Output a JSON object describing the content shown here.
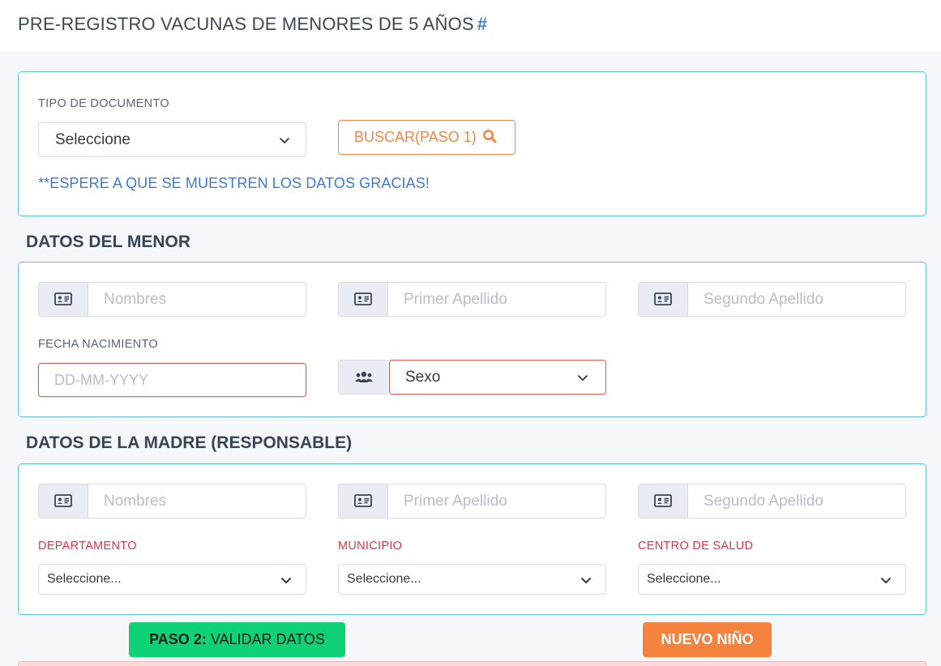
{
  "header": {
    "title": "PRE-REGISTRO VACUNAS DE MENORES DE 5 AÑOS",
    "hash": "#"
  },
  "search": {
    "doc_type_label": "TIPO DE DOCUMENTO",
    "doc_type_value": "Seleccione",
    "search_button": "BUSCAR(PASO 1)",
    "wait_message": "**ESPERE A QUE SE MUESTREN LOS DATOS GRACIAS!"
  },
  "child": {
    "section_title": "DATOS DEL MENOR",
    "first_name_placeholder": "Nombres",
    "last_name1_placeholder": "Primer Apellido",
    "last_name2_placeholder": "Segundo Apellido",
    "birthdate_label": "FECHA NACIMIENTO",
    "birthdate_placeholder": "DD-MM-YYYY",
    "sex_value": "Sexo"
  },
  "mother": {
    "section_title": "DATOS DE LA MADRE (RESPONSABLE)",
    "first_name_placeholder": "Nombres",
    "last_name1_placeholder": "Primer Apellido",
    "last_name2_placeholder": "Segundo Apellido",
    "department_label": "DEPARTAMENTO",
    "department_value": "Seleccione...",
    "municipality_label": "MUNICIPIO",
    "municipality_value": "Seleccione...",
    "health_center_label": "CENTRO DE SALUD",
    "health_center_value": "Seleccione..."
  },
  "actions": {
    "validate_prefix": "PASO 2:",
    "validate_label": " VALIDAR DATOS",
    "new_child_label": "NUEVO NIÑO"
  },
  "icons": {
    "id_card": "id-card-icon",
    "users": "users-icon",
    "search": "search-icon",
    "chevron": "chevron-down-icon"
  },
  "colors": {
    "accent_blue": "#3d7bd6",
    "card_border": "#5cc6d5",
    "orange": "#f0884a",
    "green": "#0fd277",
    "error_red": "#dc3545"
  }
}
